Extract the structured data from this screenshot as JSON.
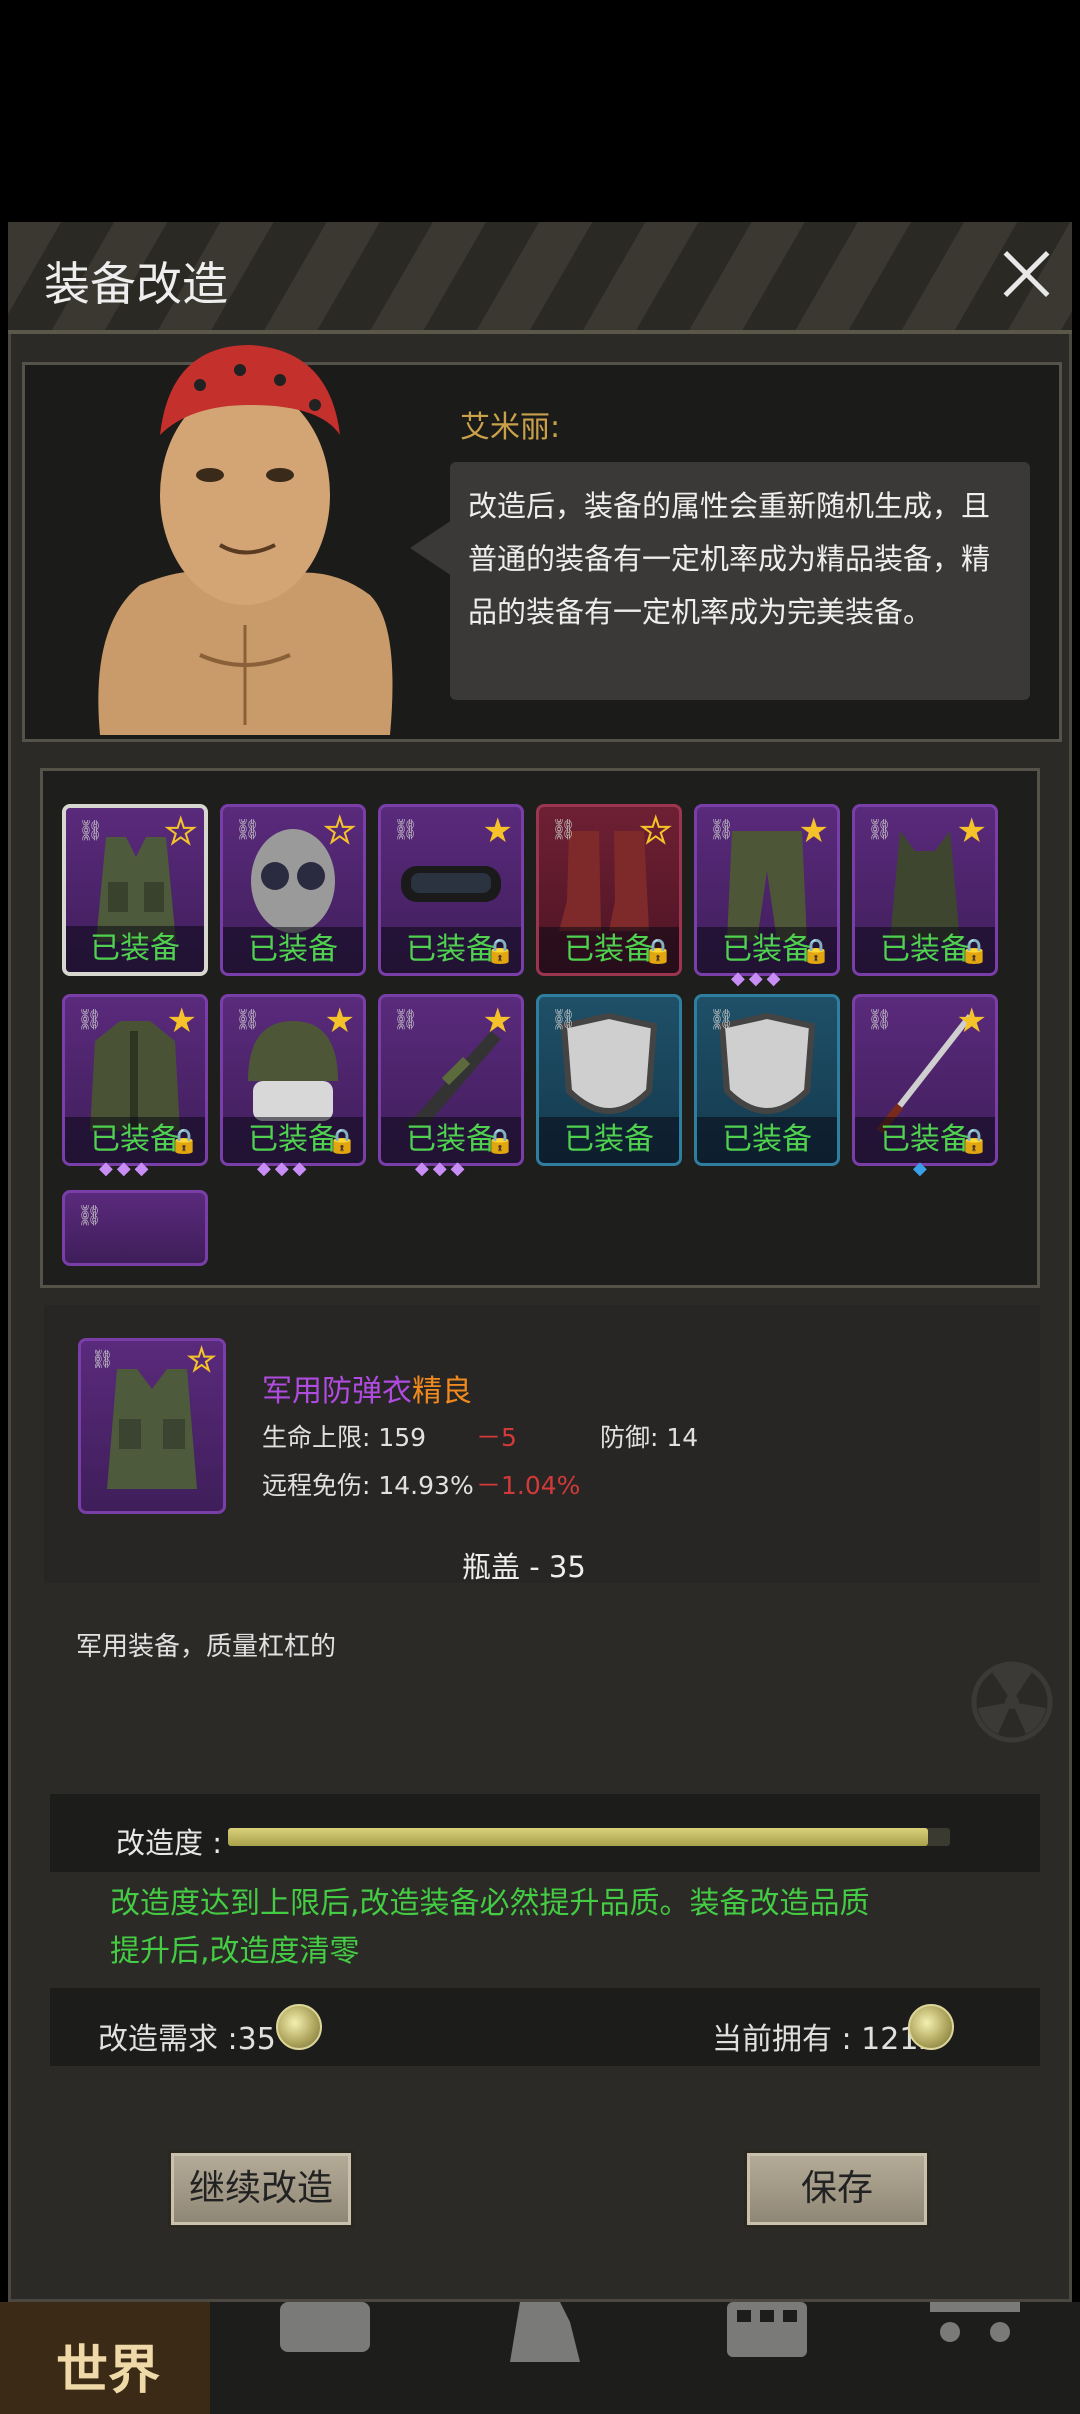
{
  "window": {
    "title": "装备改造",
    "close_icon": "close-icon"
  },
  "npc": {
    "name": "艾米丽:",
    "speech": "改造后，装备的属性会重新随机生成，且普通的装备有一定机率成为精品装备，精品的装备有一定机率成为完美装备。"
  },
  "equipment": {
    "equipped_label": "已装备",
    "slots": [
      {
        "name": "tactical-vest",
        "rarity": "purple",
        "star": "hollow",
        "locked": false,
        "gems": 0,
        "selected": true
      },
      {
        "name": "gas-mask",
        "rarity": "purple",
        "star": "hollow",
        "locked": false,
        "gems": 0
      },
      {
        "name": "goggles",
        "rarity": "purple",
        "star": "filled",
        "locked": true,
        "gems": 0
      },
      {
        "name": "red-boots",
        "rarity": "red",
        "star": "hollow",
        "locked": true,
        "gems": 0
      },
      {
        "name": "camo-pants",
        "rarity": "purple",
        "star": "filled",
        "locked": true,
        "gems": 3
      },
      {
        "name": "camo-tank-top",
        "rarity": "purple",
        "star": "filled",
        "locked": true,
        "gems": 0
      },
      {
        "name": "camo-jacket",
        "rarity": "purple",
        "star": "filled",
        "locked": true,
        "gems": 3
      },
      {
        "name": "combat-helmet",
        "rarity": "purple",
        "star": "filled",
        "locked": true,
        "gems": 3
      },
      {
        "name": "sniper-rifle",
        "rarity": "purple",
        "star": "filled",
        "locked": true,
        "gems": 3
      },
      {
        "name": "shield-1",
        "rarity": "blue",
        "star": "none",
        "locked": false,
        "gems": 0
      },
      {
        "name": "shield-2",
        "rarity": "blue",
        "star": "none",
        "locked": false,
        "gems": 0
      },
      {
        "name": "katana",
        "rarity": "purple",
        "star": "filled",
        "locked": true,
        "gems": 1,
        "gem_color": "blue"
      }
    ]
  },
  "detail": {
    "item_name": "军用防弹衣",
    "quality": "精良",
    "hp_label": "生命上限: 159",
    "hp_delta": "－5",
    "defense_label": "防御: 14",
    "ranged_label": "远程免伤: 14.93%",
    "ranged_delta": "－1.04%",
    "cost": "瓶盖 - 35",
    "description": "军用装备，质量杠杠的"
  },
  "reform": {
    "progress_label": "改造度 :",
    "progress_fraction": 0.97,
    "note": "改造度达到上限后,改造装备必然提升品质。装备改造品质提升后,改造度清零",
    "requirement_label": "改造需求 :35",
    "owned_label": "当前拥有 : 1212",
    "continue_button": "继续改造",
    "save_button": "保存"
  },
  "nav": {
    "world": "世界"
  },
  "colors": {
    "quality_orange": "#f08a1e",
    "name_purple": "#b04be0",
    "green_text": "#44cc44",
    "delta_red": "#d23a3a"
  }
}
